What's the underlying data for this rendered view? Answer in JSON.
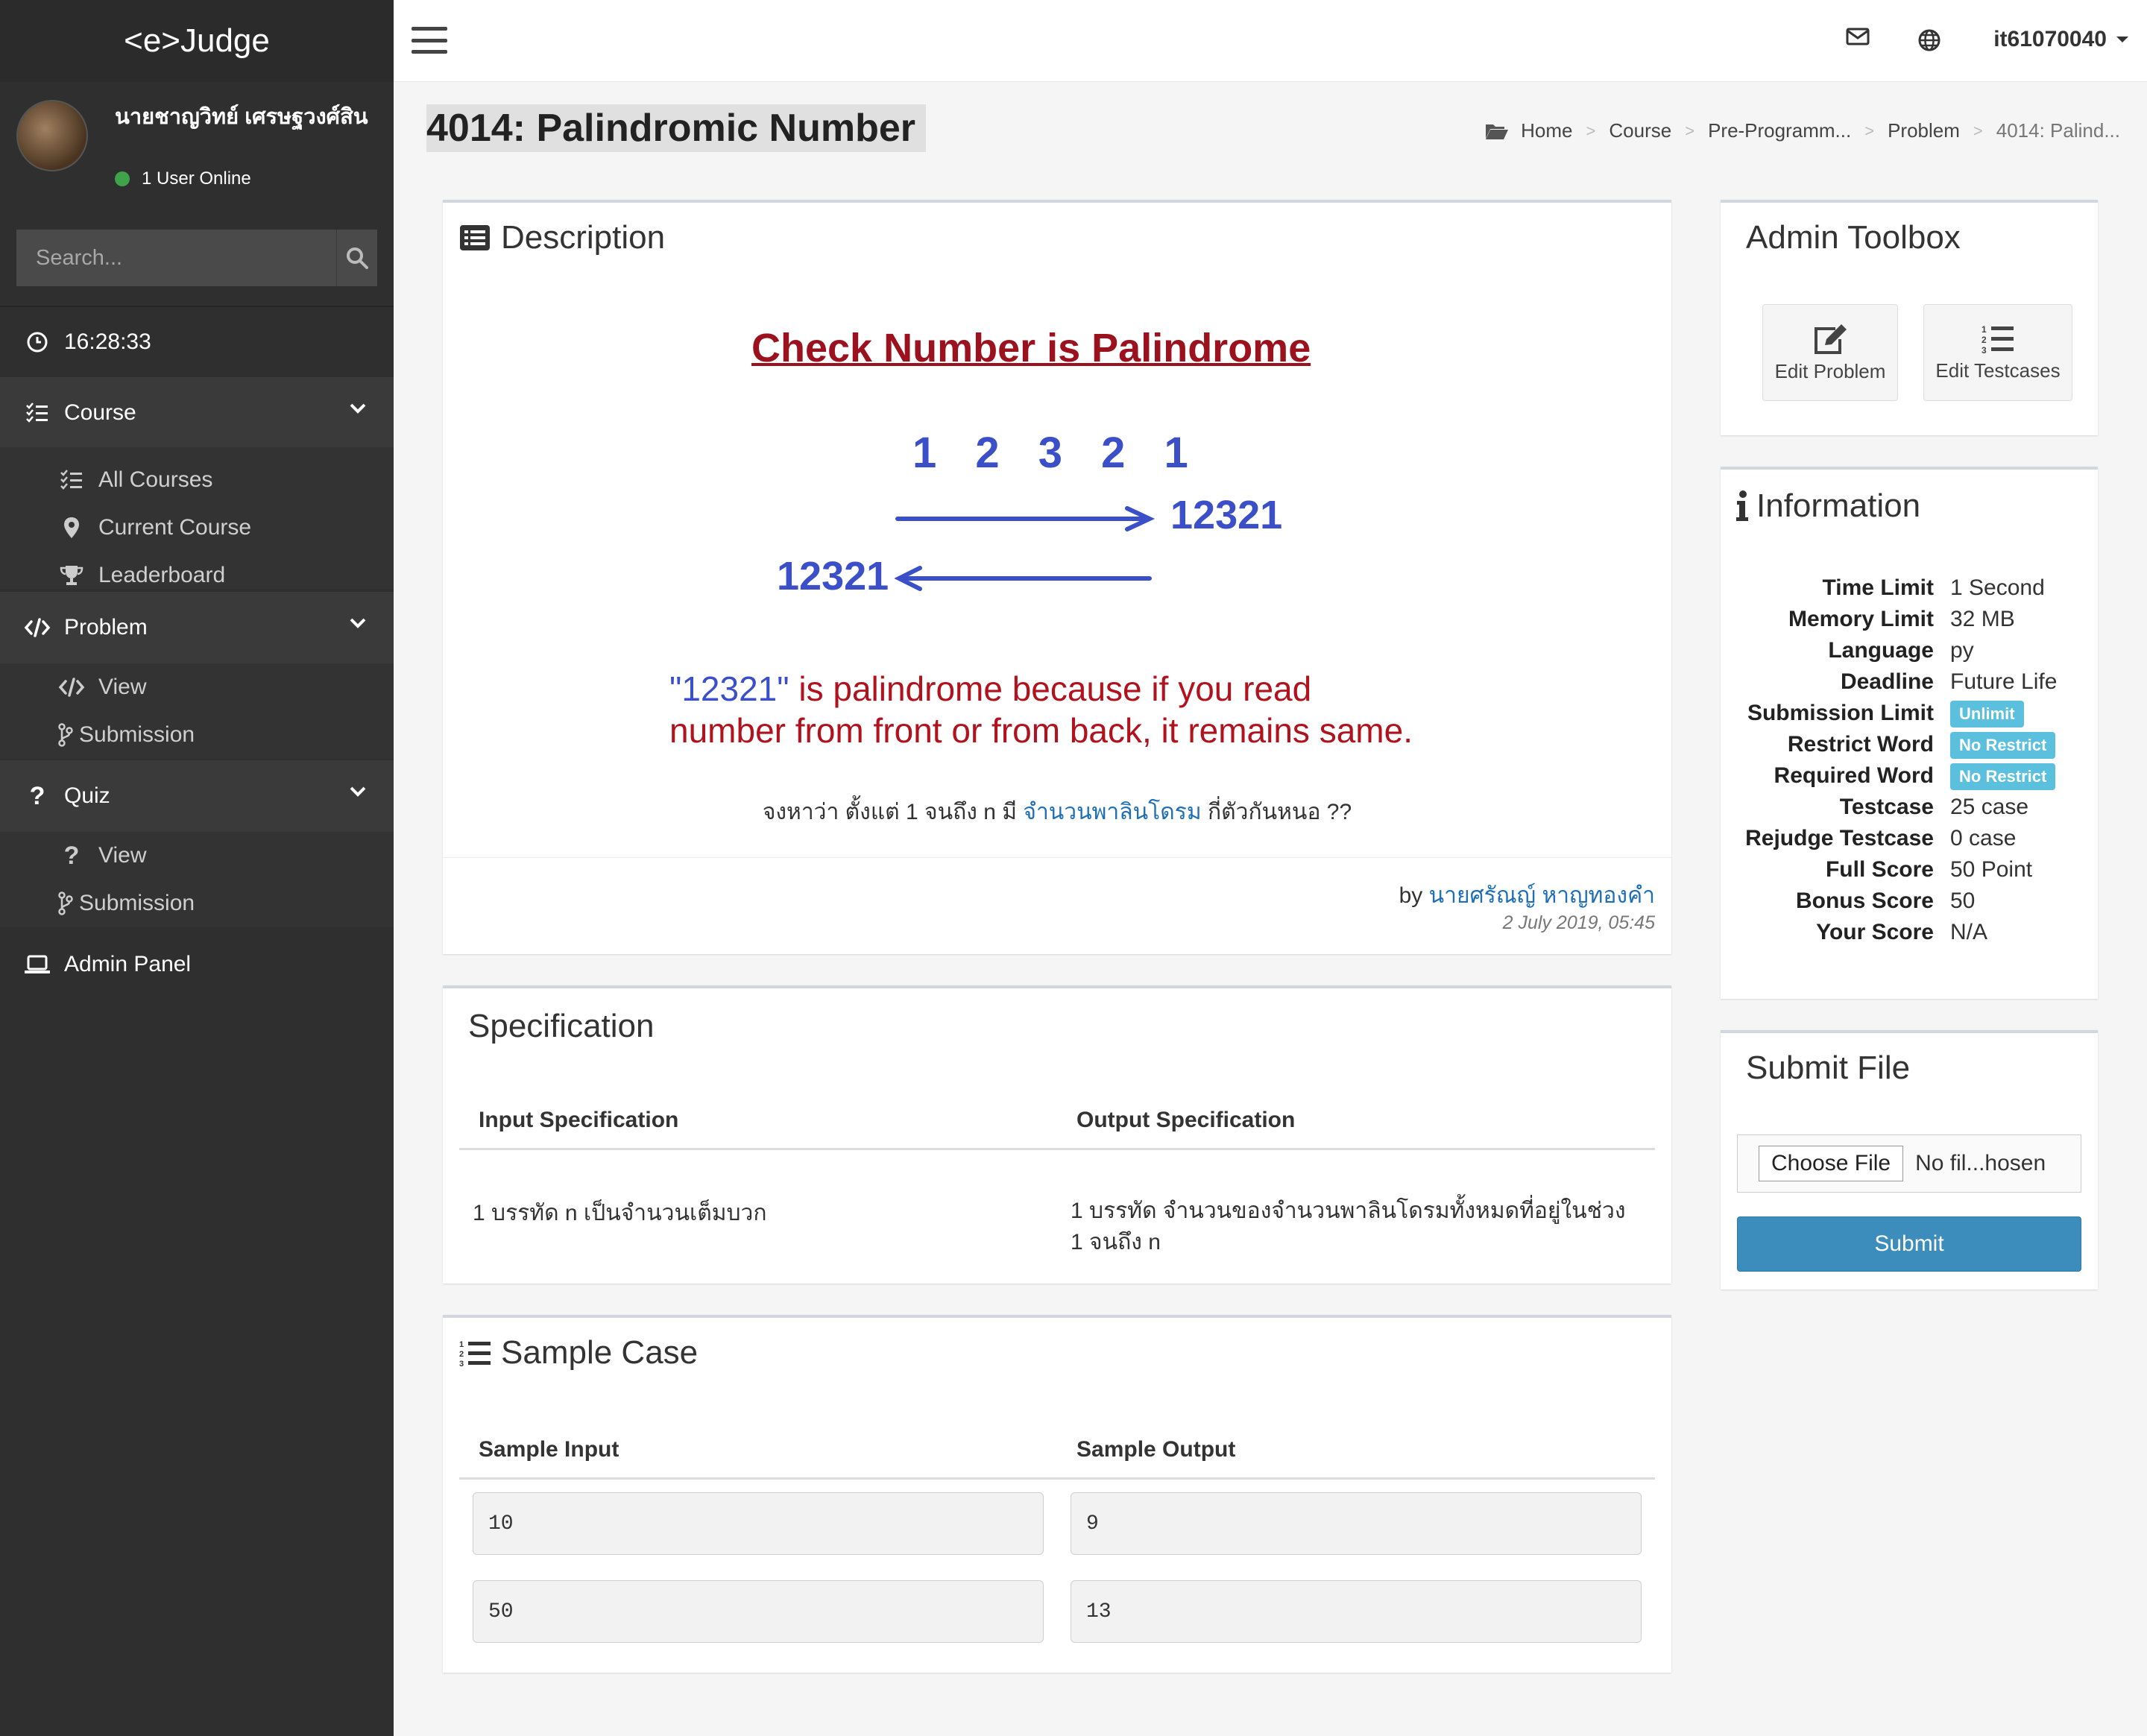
{
  "brand": "<e>Judge",
  "user": {
    "name": "นายชาญวิทย์ เศรษฐวงศ์สิน",
    "online": "1 User Online"
  },
  "search": {
    "placeholder": "Search..."
  },
  "clock": "16:28:33",
  "nav": {
    "course": {
      "label": "Course",
      "items": [
        "All Courses",
        "Current Course",
        "Leaderboard"
      ]
    },
    "problem": {
      "label": "Problem",
      "items": [
        "View",
        "Submission"
      ]
    },
    "quiz": {
      "label": "Quiz",
      "items": [
        "View",
        "Submission"
      ]
    },
    "admin": "Admin Panel"
  },
  "topbar": {
    "username": "it61070040"
  },
  "page_title": "4014: Palindromic Number",
  "breadcrumb": [
    "Home",
    "Course",
    "Pre-Programm...",
    "Problem",
    "4014: Palind..."
  ],
  "description": {
    "title": "Description",
    "image": {
      "heading": "Check Number is Palindrome",
      "digits": "1 2 3 2 1",
      "number": "12321",
      "quoted": "\"12321\"",
      "line1_rest": " is palindrome because if you read",
      "line2": "number from front or from back, it remains same."
    },
    "question_before": "จงหาว่า ตั้งแต่ 1 จนถึง n มี ",
    "question_link": "จำนวนพาลินโดรม",
    "question_after": " กี่ตัวกันหนอ ??",
    "by": "by",
    "author": "นายศรัณญ์ หาญทองคำ",
    "date": "2 July 2019, 05:45"
  },
  "specification": {
    "title": "Specification",
    "input_header": "Input Specification",
    "output_header": "Output Specification",
    "input_text": "1 บรรทัด n เป็นจำนวนเต็มบวก",
    "output_text": "1 บรรทัด จำนวนของจำนวนพาลินโดรมทั้งหมดที่อยู่ในช่วง 1 จนถึง n"
  },
  "sample": {
    "title": "Sample Case",
    "input_header": "Sample Input",
    "output_header": "Sample Output",
    "rows": [
      {
        "input": "10",
        "output": "9"
      },
      {
        "input": "50",
        "output": "13"
      }
    ]
  },
  "admin_toolbox": {
    "title": "Admin Toolbox",
    "edit_problem": "Edit Problem",
    "edit_testcases": "Edit Testcases"
  },
  "information": {
    "title": "Information",
    "rows": [
      {
        "key": "Time Limit",
        "value": "1 Second"
      },
      {
        "key": "Memory Limit",
        "value": "32 MB"
      },
      {
        "key": "Language",
        "value": "py"
      },
      {
        "key": "Deadline",
        "value": "Future Life"
      },
      {
        "key": "Submission Limit",
        "badge": "Unlimit"
      },
      {
        "key": "Restrict Word",
        "badge": "No Restrict"
      },
      {
        "key": "Required Word",
        "badge": "No Restrict"
      },
      {
        "key": "Testcase",
        "value": "25 case"
      },
      {
        "key": "Rejudge Testcase",
        "value": "0 case"
      },
      {
        "key": "Full Score",
        "value": "50 Point"
      },
      {
        "key": "Bonus Score",
        "value": "50"
      },
      {
        "key": "Your Score",
        "value": "N/A"
      }
    ]
  },
  "submit": {
    "title": "Submit File",
    "choose": "Choose File",
    "no_file": "No fil...hosen",
    "button": "Submit"
  }
}
